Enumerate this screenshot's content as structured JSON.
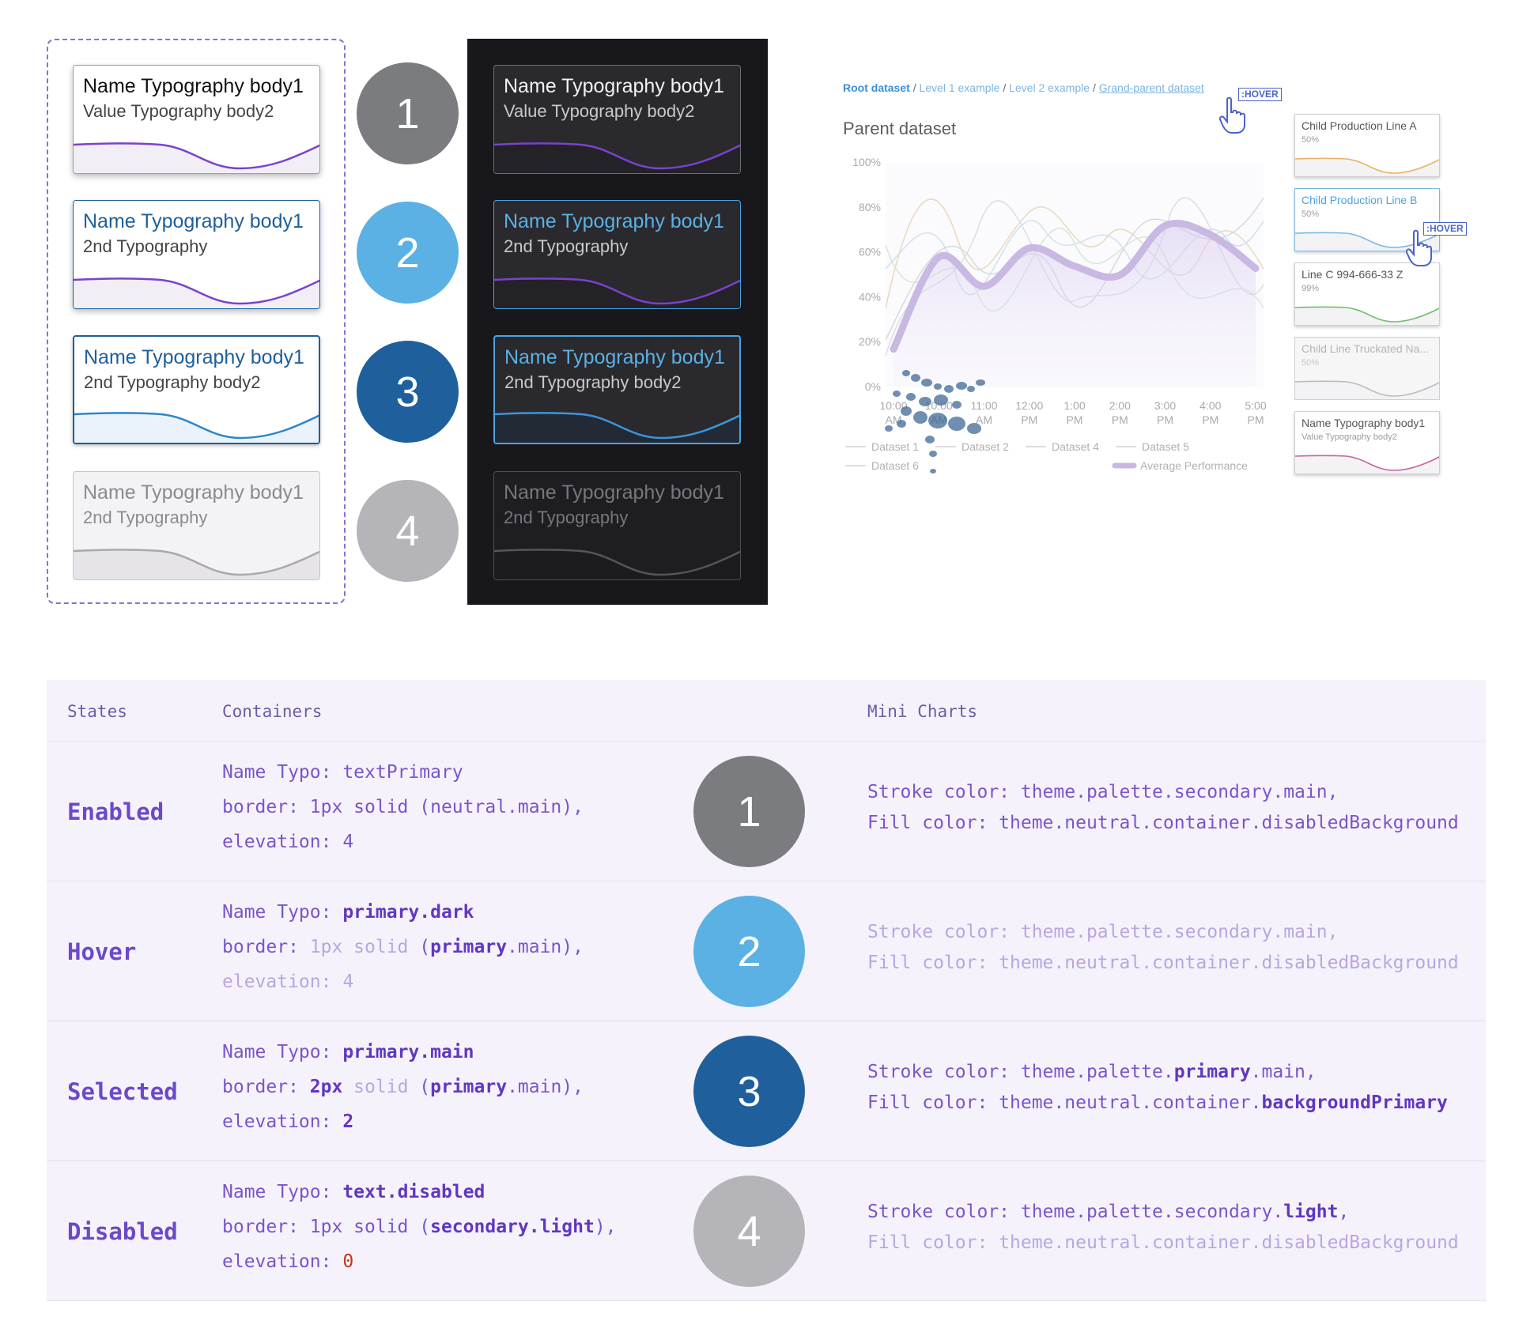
{
  "light_cards": [
    {
      "name": "Name Typography body1",
      "value": "Value Typography body2"
    },
    {
      "name": "Name Typography body1",
      "value": "2nd Typography"
    },
    {
      "name": "Name Typography body1",
      "value": "2nd Typography body2"
    },
    {
      "name": "Name Typography body1",
      "value": "2nd Typography"
    }
  ],
  "dark_cards": [
    {
      "name": "Name Typography body1",
      "value": "Value Typography body2"
    },
    {
      "name": "Name Typography body1",
      "value": "2nd Typography"
    },
    {
      "name": "Name Typography body1",
      "value": "2nd Typography body2"
    },
    {
      "name": "Name Typography body1",
      "value": "2nd Typography"
    }
  ],
  "badges": [
    "1",
    "2",
    "3",
    "4"
  ],
  "breadcrumb": {
    "root": "Root dataset",
    "sep": "/",
    "level1": "Level 1 example",
    "level2": "Level 2 example",
    "grandparent": "Grand-parent dataset",
    "hover_tag": ":HOVER"
  },
  "parent_title": "Parent dataset",
  "chart_data": {
    "type": "line",
    "title": "",
    "x": [
      "10:00 AM",
      "10:00 AM",
      "11:00 AM",
      "12:00 PM",
      "1:00 PM",
      "2:00 PM",
      "3:00 PM",
      "4:00 PM",
      "5:00 PM"
    ],
    "y_ticks": [
      "100%",
      "80%",
      "60%",
      "40%",
      "20%",
      "0%"
    ],
    "ylim": [
      0,
      100
    ],
    "series": [
      {
        "name": "Average Performance",
        "values": [
          17,
          58,
          45,
          62,
          54,
          50,
          72,
          68,
          53
        ]
      }
    ],
    "legend": [
      "Dataset 1",
      "Dataset 2",
      "Dataset 4",
      "Dataset 5",
      "Dataset 6",
      "Average Performance"
    ],
    "legend_placement": "bottom"
  },
  "mini_cards": [
    {
      "name": "Child Production Line A",
      "value": "50%",
      "color": "#e8b36a"
    },
    {
      "name": "Child Production Line B",
      "value": "50%",
      "color": "#7fb8e0",
      "hover_tag": ":HOVER"
    },
    {
      "name": "Line C 994-666-33 Z",
      "value": "99%",
      "color": "#6fbf6f"
    },
    {
      "name": "Child Line Truckated Na...",
      "value": "50%",
      "color": "#bdbdbd"
    },
    {
      "name": "Name Typography body1",
      "value": "Value Typography body2",
      "color": "#c864a0"
    }
  ],
  "table": {
    "headers": {
      "states": "States",
      "containers": "Containers",
      "mini_charts": "Mini Charts"
    },
    "rows": [
      {
        "state": "Enabled",
        "badge": "1",
        "c1a": "Name Typo: ",
        "c1b": "textPrimary",
        "c2a": "border: 1px solid (",
        "c2b": "neutral.main",
        "c2c": "),",
        "c3a": "elevation: ",
        "c3b": "4",
        "m1a": "Stroke color: theme.palette.",
        "m1b": "secondary.main",
        "m1c": ",",
        "m2a": "Fill color: theme.neutral.container.",
        "m2b": "disabledBackground"
      },
      {
        "state": "Hover",
        "badge": "2",
        "c1a": "Name Typo: ",
        "c1b": "primary",
        "c1c": ".dark",
        "c2a": "border: ",
        "c2b": "1px solid",
        "c2c": " (",
        "c2d": "primary",
        "c2e": ".main),",
        "c3a": "elevation: 4",
        "m1a": "Stroke color: theme.palette.secondary.main,",
        "m2a": "Fill color: theme.neutral.container.disabledBackground"
      },
      {
        "state": "Selected",
        "badge": "3",
        "c1a": "Name Typo: ",
        "c1b": "primary.main",
        "c2a": "border: ",
        "c2b": "2px",
        "c2c": " solid",
        "c2d": " (",
        "c2e": "primary",
        "c2f": ".main),",
        "c3a": "elevation: ",
        "c3b": "2",
        "m1a": "Stroke color: theme.palette.",
        "m1b": "primary",
        "m1c": ".main,",
        "m2a": "Fill color: theme.neutral.container.",
        "m2b": "backgroundPrimary"
      },
      {
        "state": "Disabled",
        "badge": "4",
        "c1a": "Name Typo: ",
        "c1b": "text.disabled",
        "c2a": "border: 1px solid (",
        "c2b": "secondary.light",
        "c2c": "),",
        "c3a": "elevation: ",
        "c3b": "0",
        "m1a": "Stroke color: theme.palette.secondary.",
        "m1b": "light",
        "m1c": ",",
        "m2a": "Fill color: theme.neutral.container.disabledBackground"
      }
    ]
  }
}
